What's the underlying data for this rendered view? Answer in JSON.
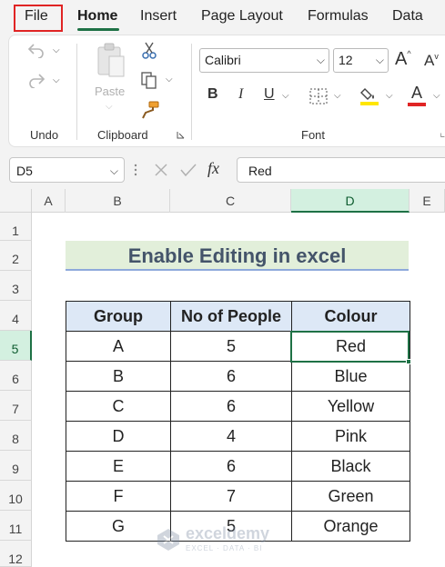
{
  "menu": {
    "file": "File",
    "home": "Home",
    "insert": "Insert",
    "page_layout": "Page Layout",
    "formulas": "Formulas",
    "data": "Data"
  },
  "ribbon": {
    "undo_group": "Undo",
    "clipboard_group": "Clipboard",
    "font_group": "Font",
    "paste_label": "Paste",
    "font_name": "Calibri",
    "font_size": "12",
    "bold": "B",
    "italic": "I",
    "underline": "U",
    "font_color_letter": "A",
    "grow_font": "A",
    "shrink_font": "A",
    "dropdown_glyph": "⌵",
    "font_color_bar": "#e02424",
    "highlight_bar": "#ffe600"
  },
  "formula_bar": {
    "cell_ref": "D5",
    "fx": "fx",
    "value": "Red"
  },
  "columns": [
    "A",
    "B",
    "C",
    "D",
    "E"
  ],
  "rows": [
    "1",
    "2",
    "3",
    "4",
    "5",
    "6",
    "7",
    "8",
    "9",
    "10",
    "11",
    "12"
  ],
  "sheet": {
    "title": "Enable Editing in excel",
    "headers": [
      "Group",
      "No of People",
      "Colour"
    ],
    "rows": [
      [
        "A",
        "5",
        "Red"
      ],
      [
        "B",
        "6",
        "Blue"
      ],
      [
        "C",
        "6",
        "Yellow"
      ],
      [
        "D",
        "4",
        "Pink"
      ],
      [
        "E",
        "6",
        "Black"
      ],
      [
        "F",
        "7",
        "Green"
      ],
      [
        "G",
        "5",
        "Orange"
      ]
    ]
  },
  "watermark": {
    "name": "exceldemy",
    "tagline": "EXCEL · DATA · BI"
  },
  "colors": {
    "accent": "#1e7145",
    "file_highlight": "#e02424",
    "title_fill": "#e2efda",
    "header_fill": "#dde8f6"
  }
}
